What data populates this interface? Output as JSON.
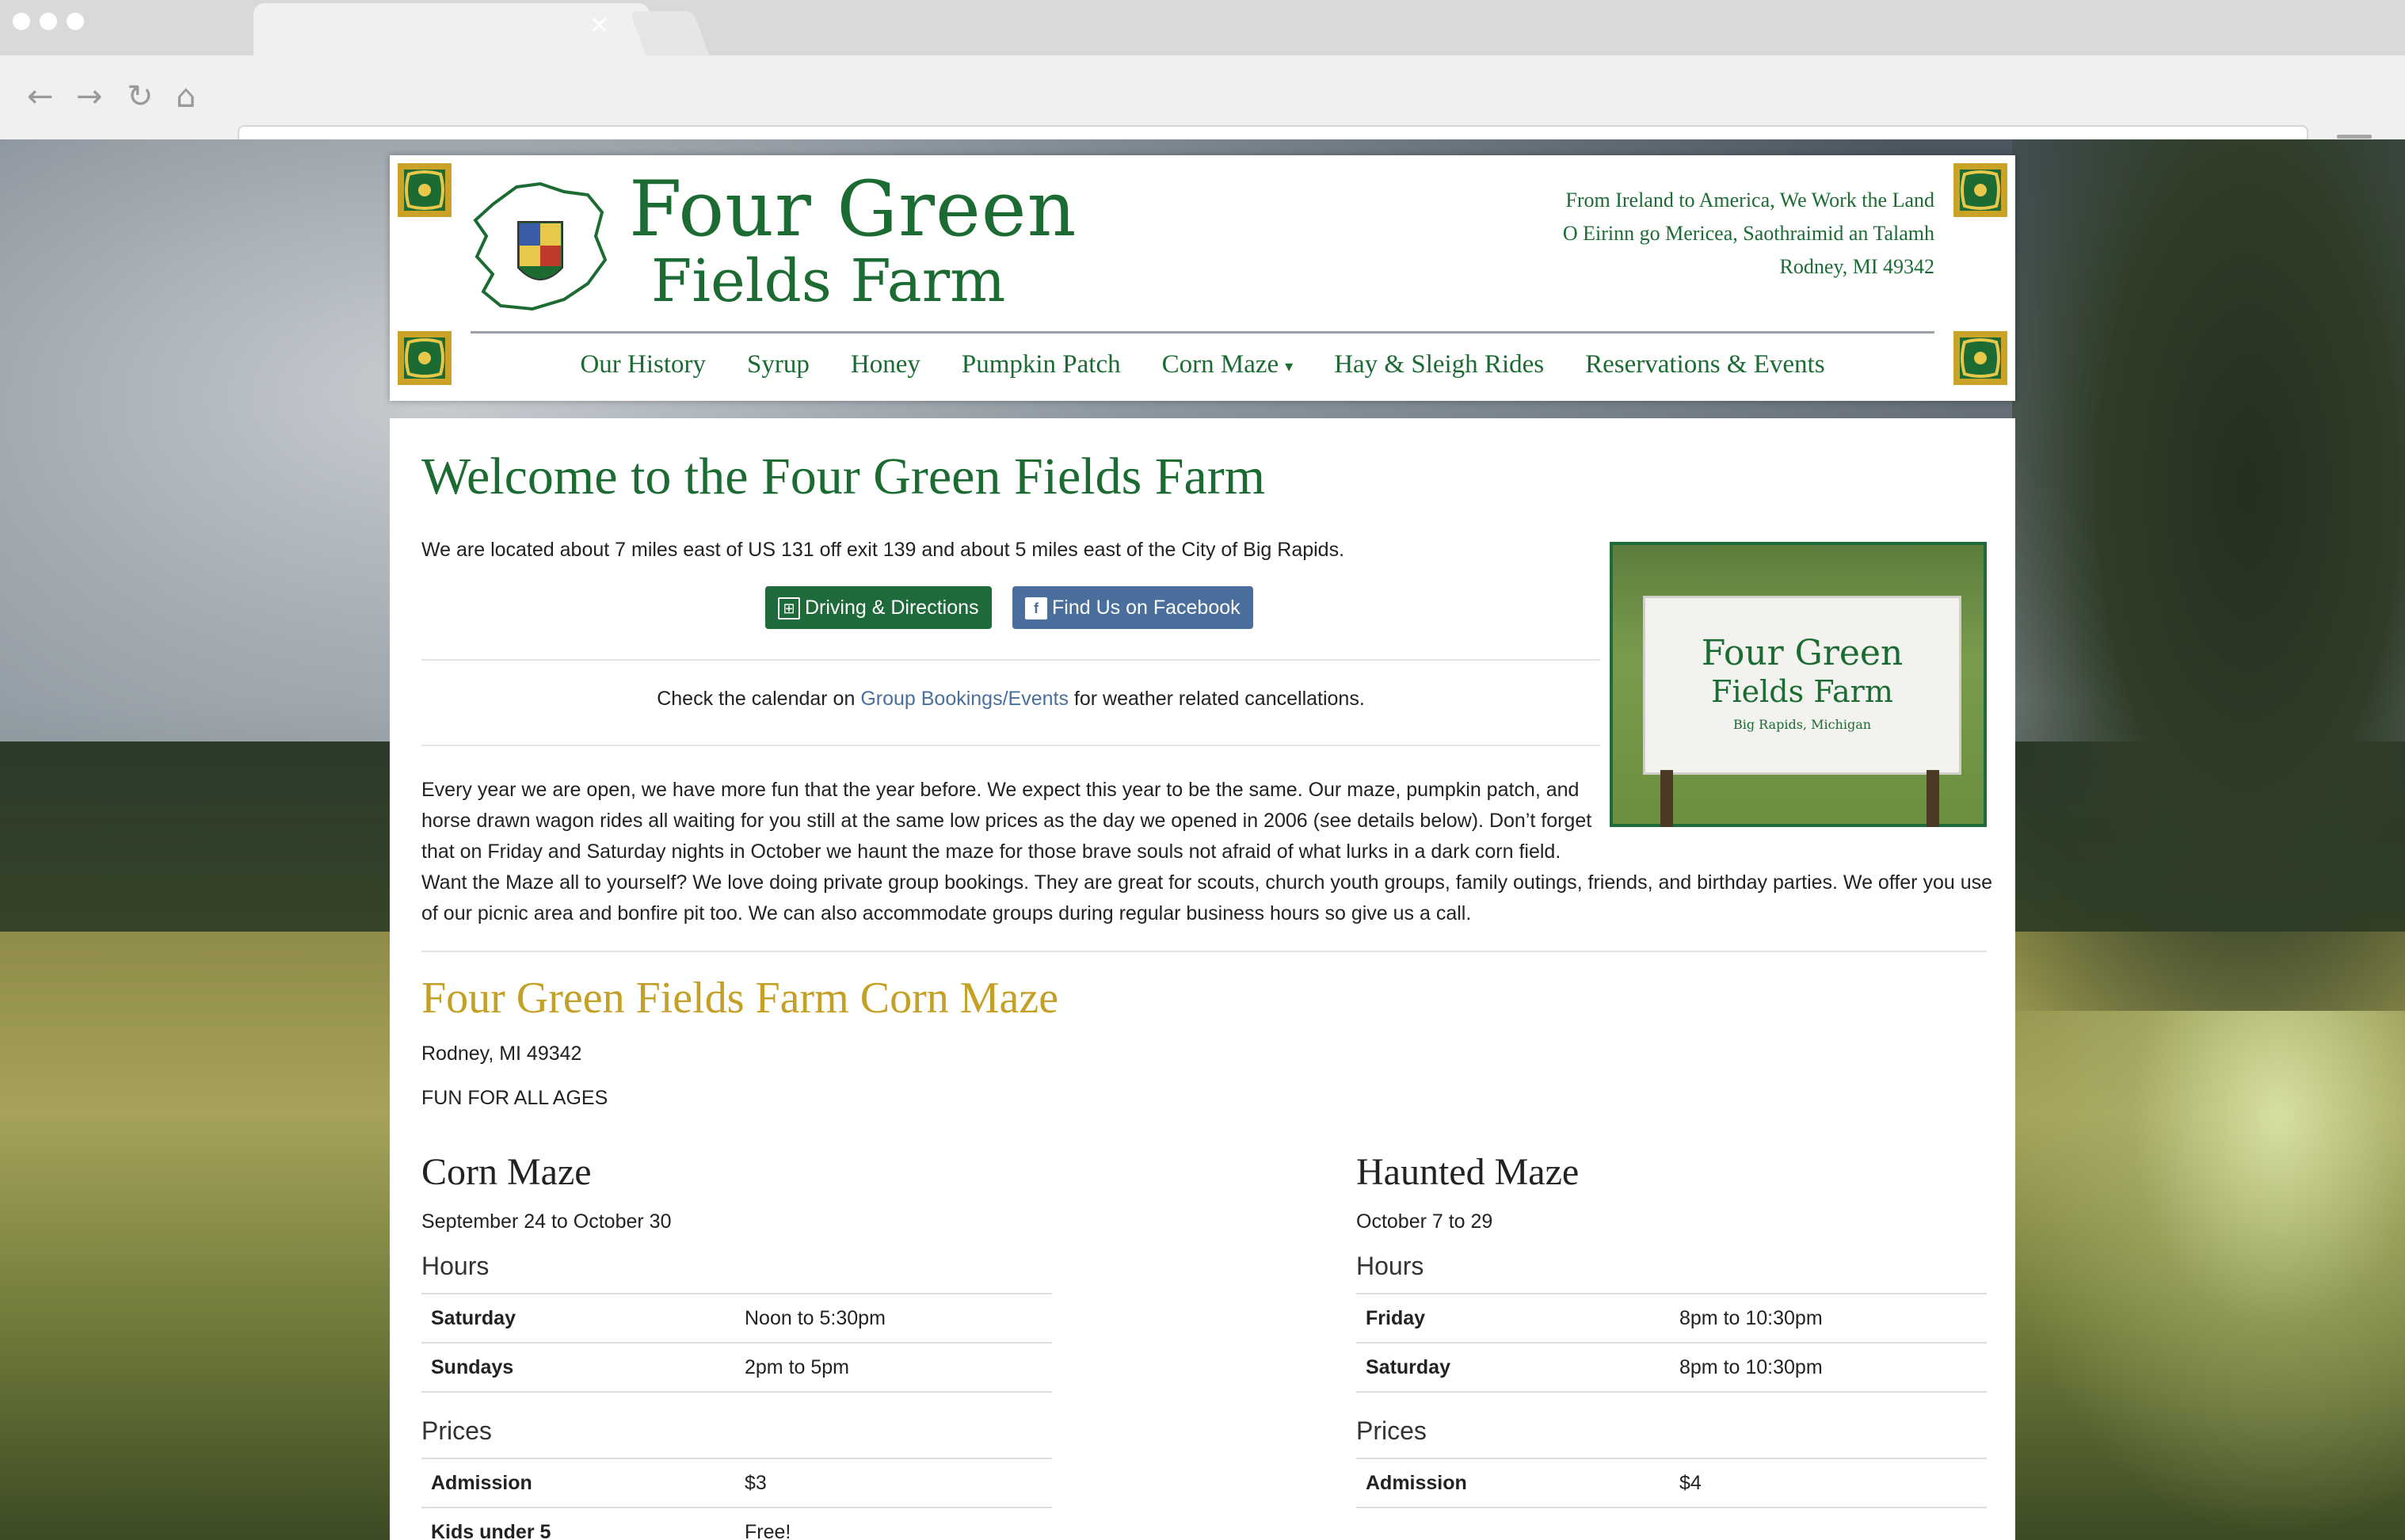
{
  "browser": {
    "url": ""
  },
  "site": {
    "logo": {
      "line1": "Four Green",
      "line2": "Fields Farm"
    },
    "tagline": [
      "From Ireland to America, We Work the Land",
      "O Eirinn go Mericea, Saothraimid an Talamh",
      "Rodney, MI 49342"
    ],
    "nav": [
      {
        "label": "Our History"
      },
      {
        "label": "Syrup"
      },
      {
        "label": "Honey"
      },
      {
        "label": "Pumpkin Patch"
      },
      {
        "label": "Corn Maze",
        "dropdown": true
      },
      {
        "label": "Hay & Sleigh Rides"
      },
      {
        "label": "Reservations & Events"
      }
    ]
  },
  "main": {
    "title": "Welcome to the Four Green Fields Farm",
    "intro": "We are located about 7 miles east of US 131 off exit 139 and about 5 miles east of the City of Big Rapids.",
    "buttons": {
      "directions": "Driving & Directions",
      "facebook": "Find Us on Facebook"
    },
    "notice": {
      "before": "Check the calendar on ",
      "link": "Group Bookings/Events",
      "after": " for weather related cancellations."
    },
    "photo_sign": {
      "line1": "Four Green",
      "line2": "Fields Farm",
      "sub": "Big Rapids, Michigan"
    },
    "paragraph": [
      "Every year we are open, we have more fun that the year before. We expect this year to be the same. Our maze, pumpkin patch, and",
      "horse drawn wagon rides all waiting for you still at the same low prices as the day we opened in 2006 (see details below). Don’t forget",
      "that on Friday and Saturday nights in October we haunt the maze for those brave souls not afraid of what lurks in a dark corn field.",
      "Want the Maze all to yourself? We love doing private group bookings. They are great for scouts, church youth groups, family outings, friends, and birthday parties. We offer you use",
      "of our picnic area and bonfire pit too. We can also accommodate groups during regular business hours so give us a call."
    ],
    "section_title": "Four Green Fields Farm Corn Maze",
    "location": "Rodney, MI 49342",
    "fun": "FUN FOR ALL AGES",
    "corn_maze": {
      "title": "Corn Maze",
      "dates": "September 24 to October 30",
      "hours_label": "Hours",
      "hours": [
        {
          "day": "Saturday",
          "time": "Noon to 5:30pm"
        },
        {
          "day": "Sundays",
          "time": "2pm to 5pm"
        }
      ],
      "prices_label": "Prices",
      "prices": [
        {
          "item": "Admission",
          "price": "$3"
        },
        {
          "item": "Kids under 5",
          "price": "Free!"
        }
      ]
    },
    "haunted_maze": {
      "title": "Haunted Maze",
      "dates": "October 7 to 29",
      "hours_label": "Hours",
      "hours": [
        {
          "day": "Friday",
          "time": "8pm to 10:30pm"
        },
        {
          "day": "Saturday",
          "time": "8pm to 10:30pm"
        }
      ],
      "prices_label": "Prices",
      "prices": [
        {
          "item": "Admission",
          "price": "$4"
        }
      ]
    }
  },
  "colors": {
    "brand_green": "#1b6b33",
    "gold": "#c5a026",
    "facebook_blue": "#4a6f9c",
    "link": "#4a6f9c"
  }
}
